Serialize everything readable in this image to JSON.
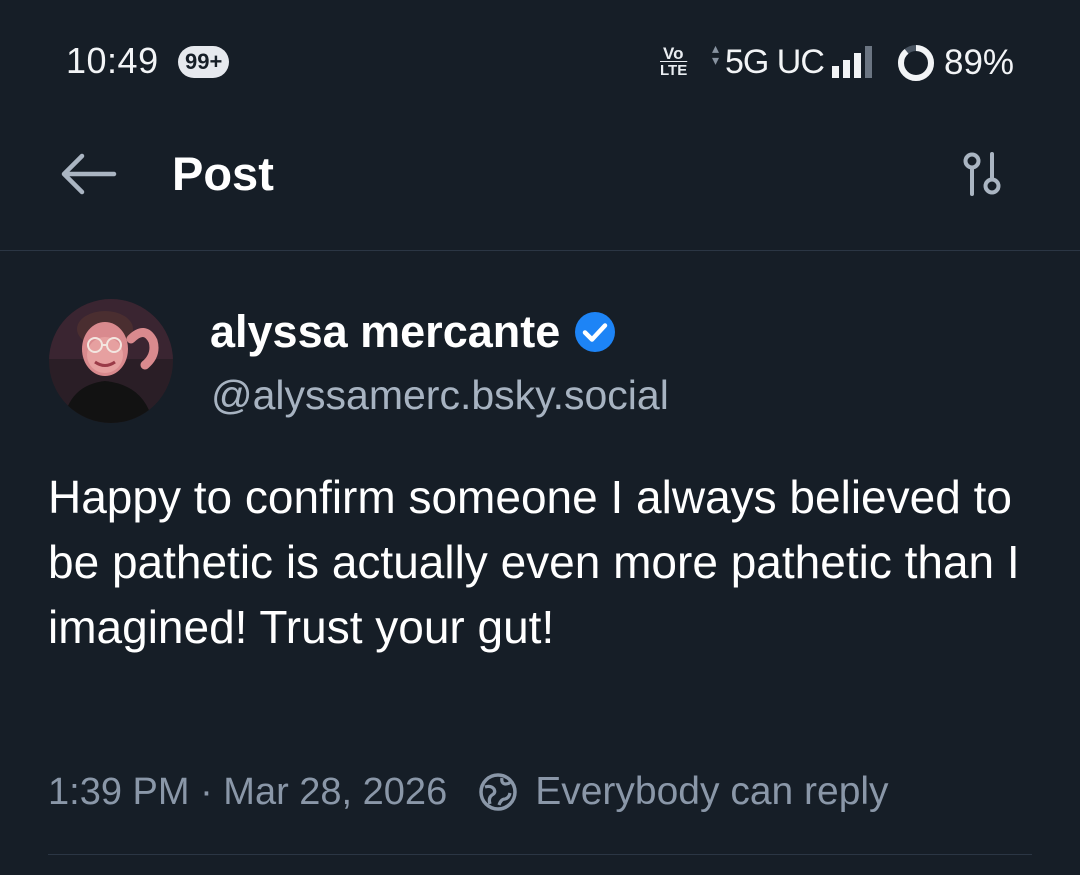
{
  "status_bar": {
    "time": "10:49",
    "notification_badge": "99+",
    "volte_top": "Vo",
    "volte_bottom": "LTE",
    "network": "5G UC",
    "battery": "89%",
    "battery_level": 0.89
  },
  "header": {
    "back_icon": "arrow-left-icon",
    "title": "Post",
    "settings_icon": "sliders-icon"
  },
  "post": {
    "display_name": "alyssa mercante",
    "verified_icon": "verified-check-icon",
    "verified_color": "#1d84f6",
    "handle": "@alyssamerc.bsky.social",
    "text": "Happy to confirm someone I always believed to be pathetic is actually even more pathetic than I imagined! Trust your gut!",
    "timestamp": "1:39 PM · Mar 28, 2026",
    "reply_icon": "globe-icon",
    "reply_setting": "Everybody can reply"
  },
  "colors": {
    "background": "#161e27",
    "muted_text": "#8a97a8",
    "handle_text": "#a7b3c1",
    "divider": "#2b3644"
  }
}
